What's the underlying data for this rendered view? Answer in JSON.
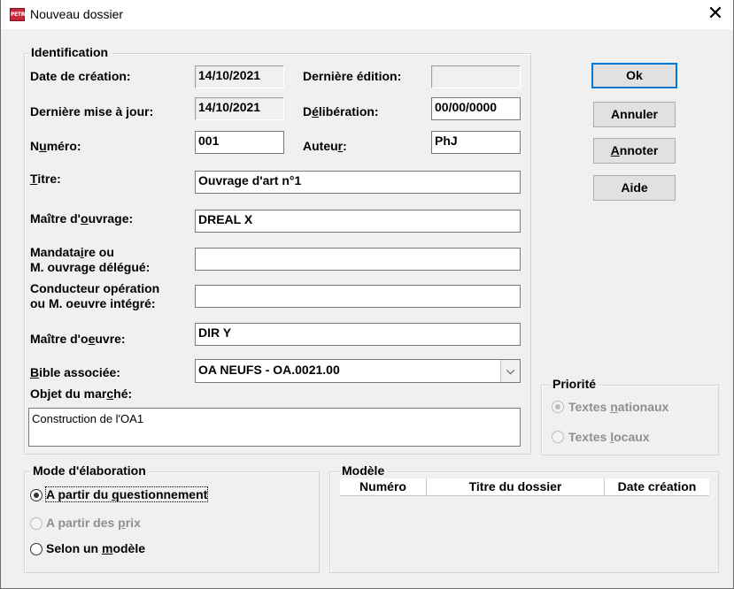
{
  "window": {
    "title": "Nouveau dossier",
    "icon": "petra-app-icon",
    "icon_text": "PETRA",
    "close": "✕"
  },
  "identification": {
    "group_title": "Identification",
    "date_creation": {
      "label": "Date de création:",
      "value": "14/10/2021"
    },
    "derniere_edition": {
      "label": "Dernière édition:",
      "value": ""
    },
    "derniere_maj": {
      "label": "Dernière mise à jour:",
      "value": "14/10/2021"
    },
    "deliberation": {
      "label_pre": "D",
      "label_acc": "é",
      "label_post": "libération:",
      "value": "00/00/0000"
    },
    "numero": {
      "label_pre": "N",
      "label_acc": "u",
      "label_post": "méro:",
      "value": "001"
    },
    "auteur": {
      "label_pre": "Auteu",
      "label_acc": "r",
      "label_post": ":",
      "value": "PhJ"
    },
    "titre": {
      "label_pre": "",
      "label_acc": "T",
      "label_post": "itre:",
      "value": "Ouvrage d'art n°1"
    },
    "maitre_ouvrage": {
      "label_pre": "Maître d'",
      "label_acc": "o",
      "label_post": "uvrage:",
      "value": "DREAL X"
    },
    "mandataire": {
      "line1_pre": "Mandata",
      "line1_acc": "i",
      "line1_post": "re ou",
      "line2": "M. ouvrage délégué:",
      "value": ""
    },
    "conducteur": {
      "line1": "Conducteur opération",
      "line2_pre": "ou M. oeuvre inté",
      "line2_acc": "g",
      "line2_post": "ré:",
      "value": ""
    },
    "maitre_oeuvre": {
      "label_pre": "Maître d'o",
      "label_acc": "e",
      "label_post": "uvre:",
      "value": "DIR Y"
    },
    "bible": {
      "label_pre": "",
      "label_acc": "B",
      "label_post": "ible associée:",
      "value": "OA NEUFS - OA.0021.00",
      "arrow": "⌵"
    },
    "objet": {
      "label_pre": "Objet du mar",
      "label_acc": "c",
      "label_post": "hé:",
      "value": "Construction de l'OA1"
    }
  },
  "buttons": {
    "ok": "Ok",
    "annuler": "Annuler",
    "annoter_acc": "A",
    "annoter_post": "nnoter",
    "aide": "Aide"
  },
  "priorite": {
    "title": "Priorité",
    "option1_pre": "Textes ",
    "option1_acc": "n",
    "option1_post": "ationaux",
    "option2_pre": "Textes ",
    "option2_acc": "l",
    "option2_post": "ocaux"
  },
  "mode": {
    "title": "Mode d'élaboration",
    "option1_pre": "A partir du ",
    "option1_acc": "q",
    "option1_post": "uestionnement",
    "option2_pre": "A partir des ",
    "option2_acc": "p",
    "option2_post": "rix",
    "option3_pre": "Selon un ",
    "option3_acc": "m",
    "option3_post": "odèle"
  },
  "modele": {
    "title": "Modèle",
    "columns": [
      "Numéro",
      "Titre du dossier",
      "Date création"
    ]
  }
}
